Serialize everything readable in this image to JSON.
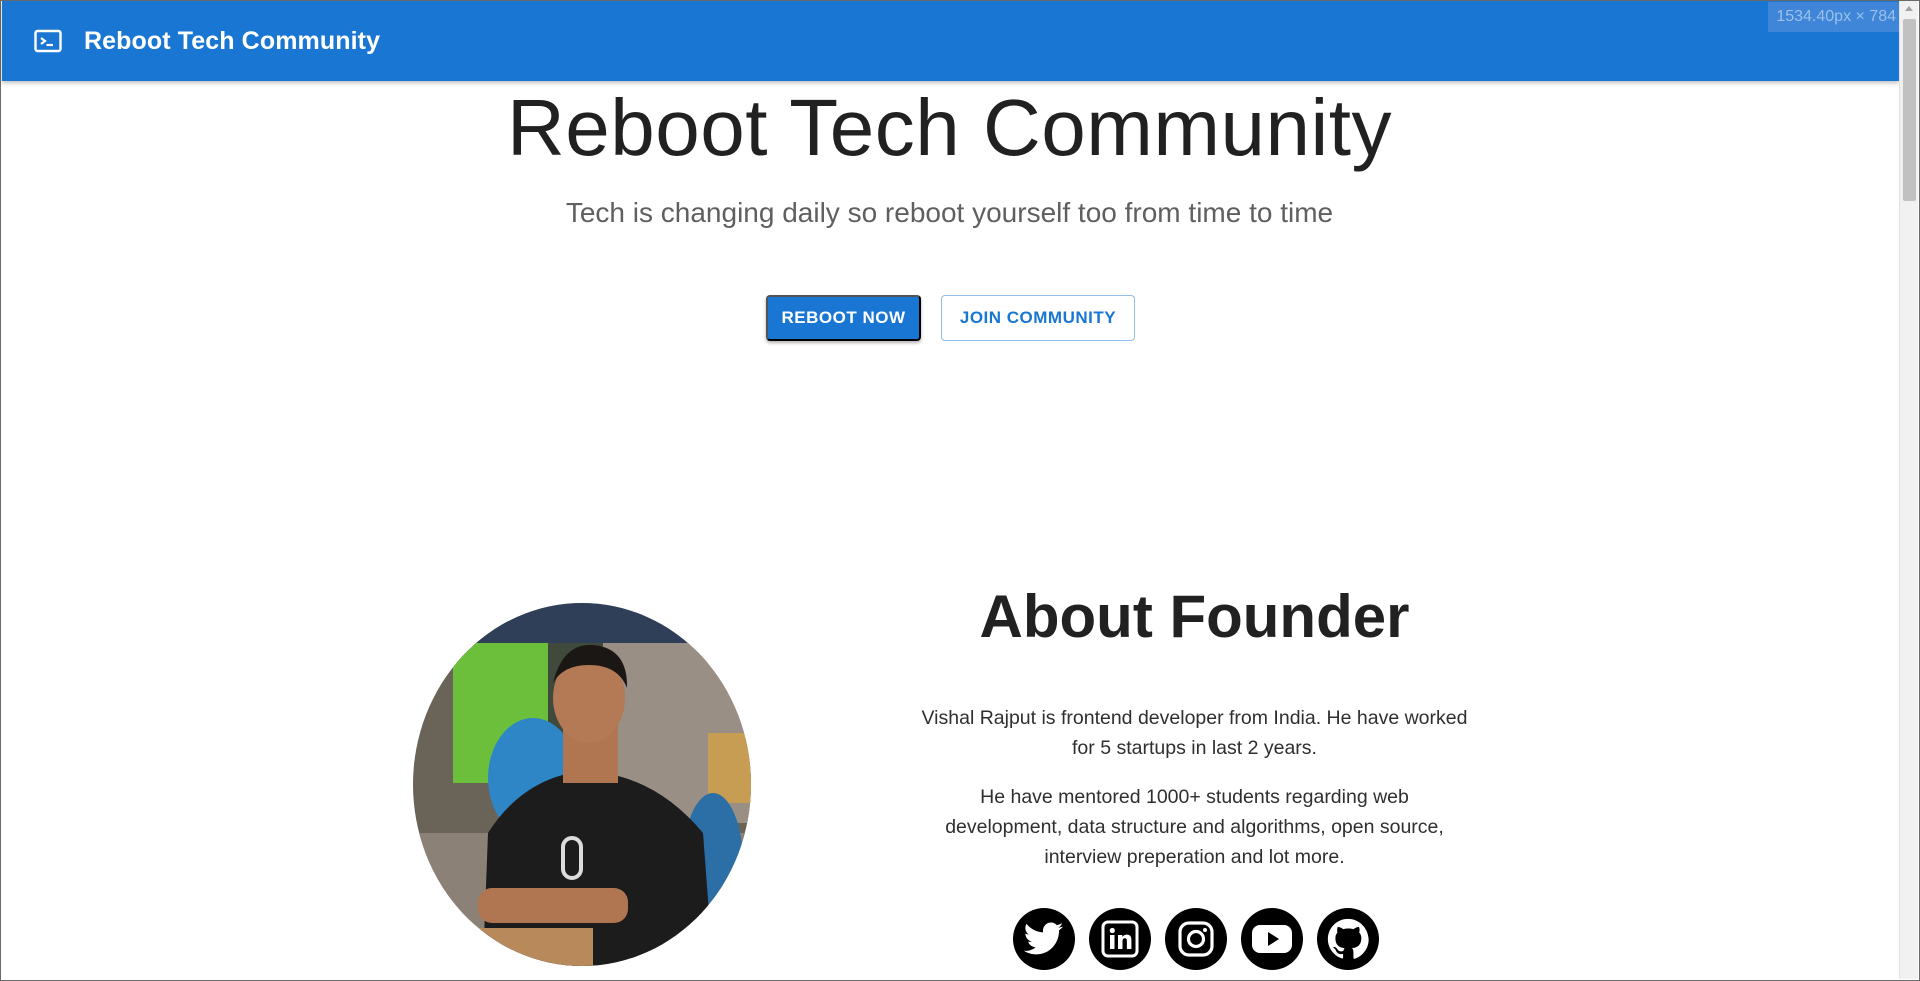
{
  "app_bar": {
    "title": "Reboot Tech Community",
    "overlay_text": "1534.40px × 784"
  },
  "hero": {
    "title": "Reboot Tech Community",
    "subtitle": "Tech is changing daily so reboot yourself too from time to time",
    "primary_button": "REBOOT NOW",
    "secondary_button": "JOIN COMMUNITY"
  },
  "about": {
    "title": "About Founder",
    "paragraph_1": "Vishal Rajput is frontend developer from India. He have worked for 5 startups in last 2 years.",
    "paragraph_2": "He have mentored 1000+ students regarding web development, data structure and algorithms, open source, interview preperation and lot more.",
    "photo_icon": "founder-photo",
    "social_icons": [
      "twitter-icon",
      "linkedin-icon",
      "instagram-icon",
      "youtube-icon",
      "github-icon"
    ]
  },
  "colors": {
    "primary": "#1976d2",
    "background": "#ffffff",
    "text": "#212121"
  }
}
